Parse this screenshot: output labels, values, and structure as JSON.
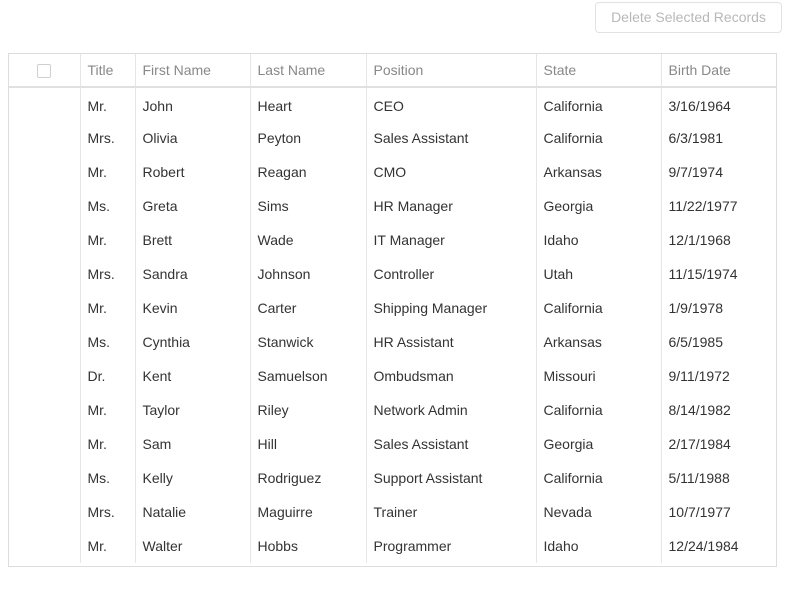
{
  "toolbar": {
    "delete_label": "Delete Selected Records"
  },
  "grid": {
    "columns": [
      "Title",
      "First Name",
      "Last Name",
      "Position",
      "State",
      "Birth Date"
    ],
    "rows": [
      [
        "Mr.",
        "John",
        "Heart",
        "CEO",
        "California",
        "3/16/1964"
      ],
      [
        "Mrs.",
        "Olivia",
        "Peyton",
        "Sales Assistant",
        "California",
        "6/3/1981"
      ],
      [
        "Mr.",
        "Robert",
        "Reagan",
        "CMO",
        "Arkansas",
        "9/7/1974"
      ],
      [
        "Ms.",
        "Greta",
        "Sims",
        "HR Manager",
        "Georgia",
        "11/22/1977"
      ],
      [
        "Mr.",
        "Brett",
        "Wade",
        "IT Manager",
        "Idaho",
        "12/1/1968"
      ],
      [
        "Mrs.",
        "Sandra",
        "Johnson",
        "Controller",
        "Utah",
        "11/15/1974"
      ],
      [
        "Mr.",
        "Kevin",
        "Carter",
        "Shipping Manager",
        "California",
        "1/9/1978"
      ],
      [
        "Ms.",
        "Cynthia",
        "Stanwick",
        "HR Assistant",
        "Arkansas",
        "6/5/1985"
      ],
      [
        "Dr.",
        "Kent",
        "Samuelson",
        "Ombudsman",
        "Missouri",
        "9/11/1972"
      ],
      [
        "Mr.",
        "Taylor",
        "Riley",
        "Network Admin",
        "California",
        "8/14/1982"
      ],
      [
        "Mr.",
        "Sam",
        "Hill",
        "Sales Assistant",
        "Georgia",
        "2/17/1984"
      ],
      [
        "Ms.",
        "Kelly",
        "Rodriguez",
        "Support Assistant",
        "California",
        "5/11/1988"
      ],
      [
        "Mrs.",
        "Natalie",
        "Maguirre",
        "Trainer",
        "Nevada",
        "10/7/1977"
      ],
      [
        "Mr.",
        "Walter",
        "Hobbs",
        "Programmer",
        "Idaho",
        "12/24/1984"
      ]
    ]
  }
}
